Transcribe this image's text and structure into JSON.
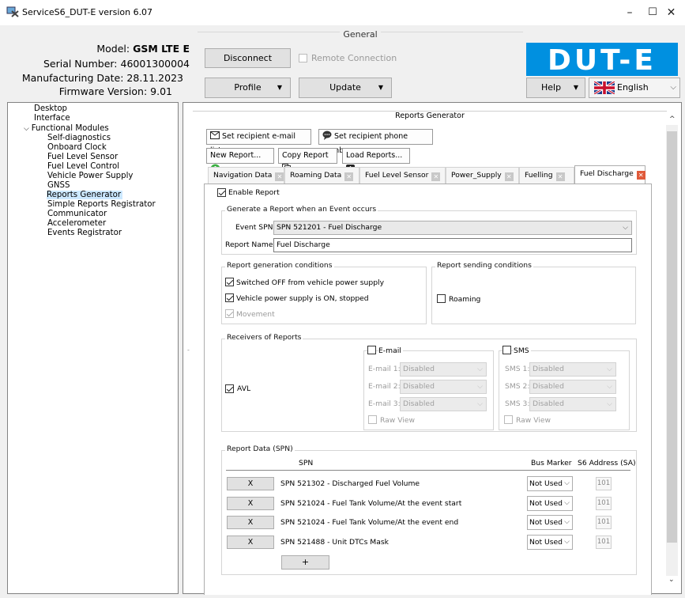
{
  "window": {
    "title": "ServiceS6_DUT-E version 6.07",
    "minimize": "–",
    "maximize": "☐",
    "close": "✕"
  },
  "header": {
    "model_label": "Model:",
    "model_value": "GSM LTE E",
    "serial_label": "Serial Number:",
    "serial_value": "46001300004",
    "mfg_label": "Manufacturing Date:",
    "mfg_value": "28.11.2023",
    "fw_label": "Firmware Version:",
    "fw_value": "9.01",
    "general_caption": "General",
    "disconnect": "Disconnect",
    "remote_connection": "Remote Connection",
    "profile": "Profile",
    "update": "Update",
    "help": "Help",
    "language": "English",
    "logo_text": "DUT-E",
    "dropdown_glyph": "▼"
  },
  "sidebar": {
    "items": [
      {
        "label": "Desktop",
        "level": 0
      },
      {
        "label": "Interface",
        "level": 0
      },
      {
        "label": "Functional Modules",
        "level": 0,
        "expanded": true
      },
      {
        "label": "Self-diagnostics",
        "level": 1
      },
      {
        "label": "Onboard Clock",
        "level": 1
      },
      {
        "label": "Fuel Level Sensor",
        "level": 1
      },
      {
        "label": "Fuel Level Control",
        "level": 1
      },
      {
        "label": "Vehicle Power Supply",
        "level": 1
      },
      {
        "label": "GNSS",
        "level": 1
      },
      {
        "label": "Reports Generator",
        "level": 1,
        "selected": true
      },
      {
        "label": "Simple Reports Registrator",
        "level": 1
      },
      {
        "label": "Communicator",
        "level": 1
      },
      {
        "label": "Accelerometer",
        "level": 1
      },
      {
        "label": "Events Registrator",
        "level": 1
      }
    ]
  },
  "reports": {
    "caption": "Reports Generator",
    "set_email": "Set recipient e-mail list...",
    "set_phone": "Set recipient phone number...",
    "new_report": "New Report...",
    "copy_report": "Copy Report",
    "load_reports": "Load Reports...",
    "tabs": [
      "Navigation Data",
      "Roaming Data",
      "Fuel Level Sensor",
      "Power_Supply",
      "Fuelling",
      "Fuel Discharge"
    ],
    "active_tab": "Fuel Discharge",
    "enable_report": "Enable Report",
    "event_group": "Generate a Report when an Event occurs",
    "event_spn_label": "Event SPN:",
    "event_spn_value": "SPN 521201 - Fuel Discharge",
    "report_name_label": "Report Name:",
    "report_name_value": "Fuel Discharge",
    "gen_conditions": "Report generation conditions",
    "cond_switched_off": "Switched OFF from vehicle power supply",
    "cond_power_on": "Vehicle power supply is ON, stopped",
    "cond_movement": "Movement",
    "send_conditions": "Report sending conditions",
    "roaming": "Roaming",
    "receivers": "Receivers of Reports",
    "avl": "AVL",
    "email": "E-mail",
    "sms": "SMS",
    "email_rows": [
      {
        "label": "E-mail 1:",
        "value": "Disabled"
      },
      {
        "label": "E-mail 2:",
        "value": "Disabled"
      },
      {
        "label": "E-mail 3:",
        "value": "Disabled"
      }
    ],
    "sms_rows": [
      {
        "label": "SMS 1:",
        "value": "Disabled"
      },
      {
        "label": "SMS 2:",
        "value": "Disabled"
      },
      {
        "label": "SMS 3:",
        "value": "Disabled"
      }
    ],
    "raw_view": "Raw View",
    "data_group": "Report Data (SPN)",
    "col_spn": "SPN",
    "col_bus": "Bus Marker",
    "col_sa": "S6 Address (SA)",
    "rows": [
      {
        "x": "X",
        "spn": "SPN 521302 - Discharged Fuel Volume",
        "bus": "Not Used",
        "sa": "101"
      },
      {
        "x": "X",
        "spn": "SPN 521024 - Fuel Tank Volume/At the event start",
        "bus": "Not Used",
        "sa": "101"
      },
      {
        "x": "X",
        "spn": "SPN 521024 - Fuel Tank Volume/At the event end",
        "bus": "Not Used",
        "sa": "101"
      },
      {
        "x": "X",
        "spn": "SPN 521488 - Unit DTCs Mask",
        "bus": "Not Used",
        "sa": "101"
      }
    ],
    "add": "+"
  }
}
